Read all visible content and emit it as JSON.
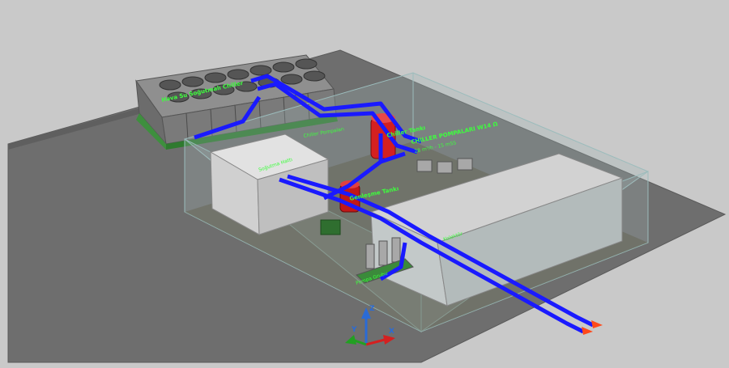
{
  "viewport": {
    "labels": {
      "chiller_unit": "Hava Su Soğutmalı Chiller",
      "chiller_pump": "CHILLER POMPALARI W14 Ω",
      "chiller_pump_spec": "28 m³/h - 15 mSS",
      "tank_top": "Chiller Tankı",
      "tank_mid": "Genleşme Tankı",
      "manifold": "Kolektör",
      "pump_group": "Pompa Grubu",
      "upper_left_note": "Soğutma Hattı",
      "lower_note": "Chiller Pompaları"
    },
    "axis": {
      "x": "X",
      "y": "Y",
      "z": "Z"
    },
    "colors": {
      "background": "#c9c9c9",
      "ground": "#6f6f6f",
      "pipe": "#1a1aff",
      "label": "#3dff3d",
      "tank": "#d42020",
      "room_box": "#a9b6b6"
    }
  }
}
